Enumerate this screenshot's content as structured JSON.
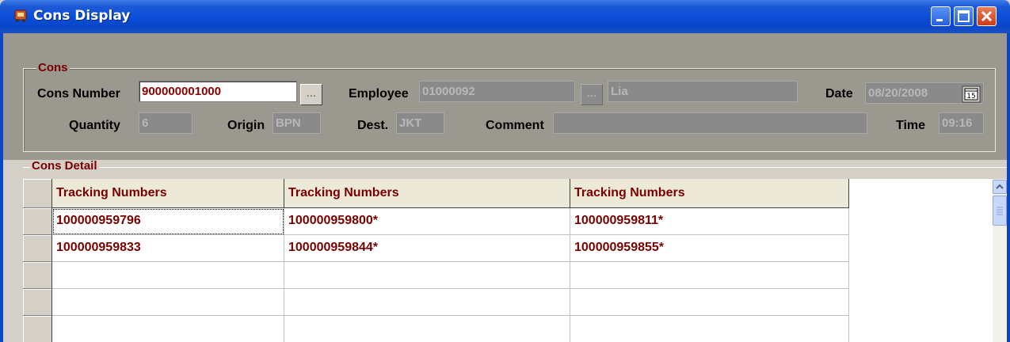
{
  "window": {
    "title": "Cons Display",
    "icon": "app-icon",
    "controls": [
      "minimize-icon",
      "maximize-icon",
      "close-icon"
    ]
  },
  "cons": {
    "legend": "Cons",
    "cons_number_label": "Cons Number",
    "cons_number_value": "900000001000",
    "employee_label": "Employee",
    "employee_id": "01000092",
    "employee_name": "Lia",
    "date_label": "Date",
    "date_value": "08/20/2008",
    "calendar_icon_text": "15",
    "quantity_label": "Quantity",
    "quantity_value": "6",
    "origin_label": "Origin",
    "origin_value": "BPN",
    "dest_label": "Dest.",
    "dest_value": "JKT",
    "comment_label": "Comment",
    "comment_value": "",
    "time_label": "Time",
    "time_value": "09:16",
    "lookup_button_label": "..."
  },
  "detail": {
    "legend": "Cons Detail",
    "columns": [
      "Tracking Numbers",
      "Tracking Numbers",
      "Tracking Numbers"
    ],
    "rows": [
      [
        "100000959796",
        "100000959800*",
        "100000959811*"
      ],
      [
        "100000959833",
        "100000959844*",
        "100000959855*"
      ],
      [
        "",
        "",
        ""
      ],
      [
        "",
        "",
        ""
      ],
      [
        "",
        "",
        ""
      ]
    ]
  },
  "colors": {
    "title_bar": "#0a46c8",
    "accent_text": "#7a0000",
    "panel": "#9b9890",
    "disabled_field": "#8a8a8a"
  }
}
